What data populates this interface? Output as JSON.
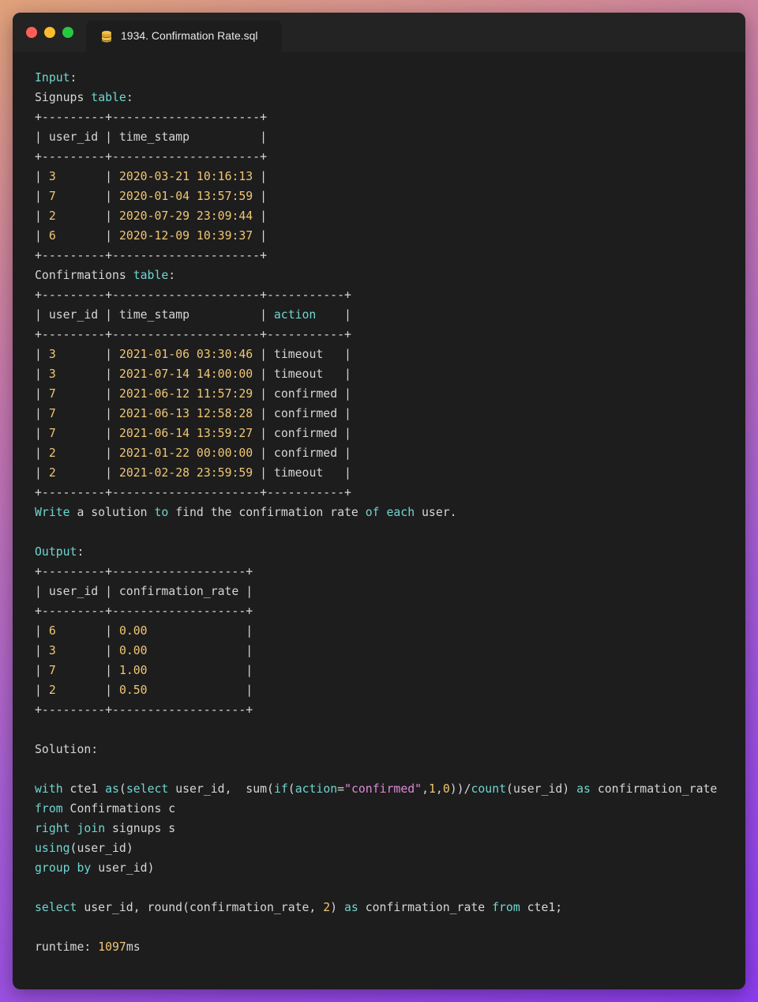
{
  "window": {
    "tab_title": "1934. Confirmation Rate.sql",
    "tab_icon": "database-icon"
  },
  "colors": {
    "keyword": "#6fd6d0",
    "number": "#f0c674",
    "string": "#e08ad8",
    "plain": "#d6d6d6",
    "background": "#1d1d1d"
  },
  "code_lines": [
    [
      {
        "t": "Input",
        "c": "kw"
      },
      {
        "t": ":",
        "c": "pl"
      }
    ],
    [
      {
        "t": "Signups ",
        "c": "pl"
      },
      {
        "t": "table",
        "c": "kw"
      },
      {
        "t": ":",
        "c": "pl"
      }
    ],
    [
      {
        "t": "+---------+---------------------+",
        "c": "pl"
      }
    ],
    [
      {
        "t": "| user_id | time_stamp          |",
        "c": "pl"
      }
    ],
    [
      {
        "t": "+---------+---------------------+",
        "c": "pl"
      }
    ],
    [
      {
        "t": "| ",
        "c": "pl"
      },
      {
        "t": "3",
        "c": "num"
      },
      {
        "t": "       | ",
        "c": "pl"
      },
      {
        "t": "2020-03-21 10:16:13",
        "c": "num"
      },
      {
        "t": " |",
        "c": "pl"
      }
    ],
    [
      {
        "t": "| ",
        "c": "pl"
      },
      {
        "t": "7",
        "c": "num"
      },
      {
        "t": "       | ",
        "c": "pl"
      },
      {
        "t": "2020-01-04 13:57:59",
        "c": "num"
      },
      {
        "t": " |",
        "c": "pl"
      }
    ],
    [
      {
        "t": "| ",
        "c": "pl"
      },
      {
        "t": "2",
        "c": "num"
      },
      {
        "t": "       | ",
        "c": "pl"
      },
      {
        "t": "2020-07-29 23:09:44",
        "c": "num"
      },
      {
        "t": " |",
        "c": "pl"
      }
    ],
    [
      {
        "t": "| ",
        "c": "pl"
      },
      {
        "t": "6",
        "c": "num"
      },
      {
        "t": "       | ",
        "c": "pl"
      },
      {
        "t": "2020-12-09 10:39:37",
        "c": "num"
      },
      {
        "t": " |",
        "c": "pl"
      }
    ],
    [
      {
        "t": "+---------+---------------------+",
        "c": "pl"
      }
    ],
    [
      {
        "t": "Confirmations ",
        "c": "pl"
      },
      {
        "t": "table",
        "c": "kw"
      },
      {
        "t": ":",
        "c": "pl"
      }
    ],
    [
      {
        "t": "+---------+---------------------+-----------+",
        "c": "pl"
      }
    ],
    [
      {
        "t": "| user_id | time_stamp          | ",
        "c": "pl"
      },
      {
        "t": "action",
        "c": "kw"
      },
      {
        "t": "    |",
        "c": "pl"
      }
    ],
    [
      {
        "t": "+---------+---------------------+-----------+",
        "c": "pl"
      }
    ],
    [
      {
        "t": "| ",
        "c": "pl"
      },
      {
        "t": "3",
        "c": "num"
      },
      {
        "t": "       | ",
        "c": "pl"
      },
      {
        "t": "2021-01-06 03:30:46",
        "c": "num"
      },
      {
        "t": " | timeout   |",
        "c": "pl"
      }
    ],
    [
      {
        "t": "| ",
        "c": "pl"
      },
      {
        "t": "3",
        "c": "num"
      },
      {
        "t": "       | ",
        "c": "pl"
      },
      {
        "t": "2021-07-14 14:00:00",
        "c": "num"
      },
      {
        "t": " | timeout   |",
        "c": "pl"
      }
    ],
    [
      {
        "t": "| ",
        "c": "pl"
      },
      {
        "t": "7",
        "c": "num"
      },
      {
        "t": "       | ",
        "c": "pl"
      },
      {
        "t": "2021-06-12 11:57:29",
        "c": "num"
      },
      {
        "t": " | confirmed |",
        "c": "pl"
      }
    ],
    [
      {
        "t": "| ",
        "c": "pl"
      },
      {
        "t": "7",
        "c": "num"
      },
      {
        "t": "       | ",
        "c": "pl"
      },
      {
        "t": "2021-06-13 12:58:28",
        "c": "num"
      },
      {
        "t": " | confirmed |",
        "c": "pl"
      }
    ],
    [
      {
        "t": "| ",
        "c": "pl"
      },
      {
        "t": "7",
        "c": "num"
      },
      {
        "t": "       | ",
        "c": "pl"
      },
      {
        "t": "2021-06-14 13:59:27",
        "c": "num"
      },
      {
        "t": " | confirmed |",
        "c": "pl"
      }
    ],
    [
      {
        "t": "| ",
        "c": "pl"
      },
      {
        "t": "2",
        "c": "num"
      },
      {
        "t": "       | ",
        "c": "pl"
      },
      {
        "t": "2021-01-22 00:00:00",
        "c": "num"
      },
      {
        "t": " | confirmed |",
        "c": "pl"
      }
    ],
    [
      {
        "t": "| ",
        "c": "pl"
      },
      {
        "t": "2",
        "c": "num"
      },
      {
        "t": "       | ",
        "c": "pl"
      },
      {
        "t": "2021-02-28 23:59:59",
        "c": "num"
      },
      {
        "t": " | timeout   |",
        "c": "pl"
      }
    ],
    [
      {
        "t": "+---------+---------------------+-----------+",
        "c": "pl"
      }
    ],
    [
      {
        "t": "Write",
        "c": "kw"
      },
      {
        "t": " a solution ",
        "c": "pl"
      },
      {
        "t": "to",
        "c": "kw"
      },
      {
        "t": " find the confirmation rate ",
        "c": "pl"
      },
      {
        "t": "of",
        "c": "kw"
      },
      {
        "t": " ",
        "c": "pl"
      },
      {
        "t": "each",
        "c": "kw"
      },
      {
        "t": " user.",
        "c": "pl"
      }
    ],
    [
      {
        "t": "",
        "c": "pl"
      }
    ],
    [
      {
        "t": "Output",
        "c": "kw"
      },
      {
        "t": ":",
        "c": "pl"
      }
    ],
    [
      {
        "t": "+---------+-------------------+",
        "c": "pl"
      }
    ],
    [
      {
        "t": "| user_id | confirmation_rate |",
        "c": "pl"
      }
    ],
    [
      {
        "t": "+---------+-------------------+",
        "c": "pl"
      }
    ],
    [
      {
        "t": "| ",
        "c": "pl"
      },
      {
        "t": "6",
        "c": "num"
      },
      {
        "t": "       | ",
        "c": "pl"
      },
      {
        "t": "0.00",
        "c": "num"
      },
      {
        "t": "              |",
        "c": "pl"
      }
    ],
    [
      {
        "t": "| ",
        "c": "pl"
      },
      {
        "t": "3",
        "c": "num"
      },
      {
        "t": "       | ",
        "c": "pl"
      },
      {
        "t": "0.00",
        "c": "num"
      },
      {
        "t": "              |",
        "c": "pl"
      }
    ],
    [
      {
        "t": "| ",
        "c": "pl"
      },
      {
        "t": "7",
        "c": "num"
      },
      {
        "t": "       | ",
        "c": "pl"
      },
      {
        "t": "1.00",
        "c": "num"
      },
      {
        "t": "              |",
        "c": "pl"
      }
    ],
    [
      {
        "t": "| ",
        "c": "pl"
      },
      {
        "t": "2",
        "c": "num"
      },
      {
        "t": "       | ",
        "c": "pl"
      },
      {
        "t": "0.50",
        "c": "num"
      },
      {
        "t": "              |",
        "c": "pl"
      }
    ],
    [
      {
        "t": "+---------+-------------------+",
        "c": "pl"
      }
    ],
    [
      {
        "t": "",
        "c": "pl"
      }
    ],
    [
      {
        "t": "Solution:",
        "c": "pl"
      }
    ],
    [
      {
        "t": "",
        "c": "pl"
      }
    ],
    [
      {
        "t": "with",
        "c": "kw"
      },
      {
        "t": " cte1 ",
        "c": "pl"
      },
      {
        "t": "as",
        "c": "kw"
      },
      {
        "t": "(",
        "c": "pl"
      },
      {
        "t": "select",
        "c": "kw"
      },
      {
        "t": " user_id,  sum(",
        "c": "pl"
      },
      {
        "t": "if",
        "c": "kw"
      },
      {
        "t": "(",
        "c": "pl"
      },
      {
        "t": "action",
        "c": "kw"
      },
      {
        "t": "=",
        "c": "pl"
      },
      {
        "t": "\"confirmed\"",
        "c": "str"
      },
      {
        "t": ",",
        "c": "pl"
      },
      {
        "t": "1",
        "c": "num"
      },
      {
        "t": ",",
        "c": "pl"
      },
      {
        "t": "0",
        "c": "num"
      },
      {
        "t": "))/",
        "c": "pl"
      },
      {
        "t": "count",
        "c": "kw"
      },
      {
        "t": "(user_id) ",
        "c": "pl"
      },
      {
        "t": "as",
        "c": "kw"
      },
      {
        "t": " confirmation_rate",
        "c": "pl"
      }
    ],
    [
      {
        "t": "from",
        "c": "kw"
      },
      {
        "t": " Confirmations c",
        "c": "pl"
      }
    ],
    [
      {
        "t": "right",
        "c": "kw"
      },
      {
        "t": " ",
        "c": "pl"
      },
      {
        "t": "join",
        "c": "kw"
      },
      {
        "t": " signups s",
        "c": "pl"
      }
    ],
    [
      {
        "t": "using",
        "c": "kw"
      },
      {
        "t": "(user_id)",
        "c": "pl"
      }
    ],
    [
      {
        "t": "group",
        "c": "kw"
      },
      {
        "t": " ",
        "c": "pl"
      },
      {
        "t": "by",
        "c": "kw"
      },
      {
        "t": " user_id)",
        "c": "pl"
      }
    ],
    [
      {
        "t": "",
        "c": "pl"
      }
    ],
    [
      {
        "t": "select",
        "c": "kw"
      },
      {
        "t": " user_id, round(confirmation_rate, ",
        "c": "pl"
      },
      {
        "t": "2",
        "c": "num"
      },
      {
        "t": ") ",
        "c": "pl"
      },
      {
        "t": "as",
        "c": "kw"
      },
      {
        "t": " confirmation_rate ",
        "c": "pl"
      },
      {
        "t": "from",
        "c": "kw"
      },
      {
        "t": " cte1;",
        "c": "pl"
      }
    ],
    [
      {
        "t": "",
        "c": "pl"
      }
    ],
    [
      {
        "t": "runtime: ",
        "c": "pl"
      },
      {
        "t": "1097",
        "c": "num"
      },
      {
        "t": "ms",
        "c": "pl"
      }
    ]
  ]
}
